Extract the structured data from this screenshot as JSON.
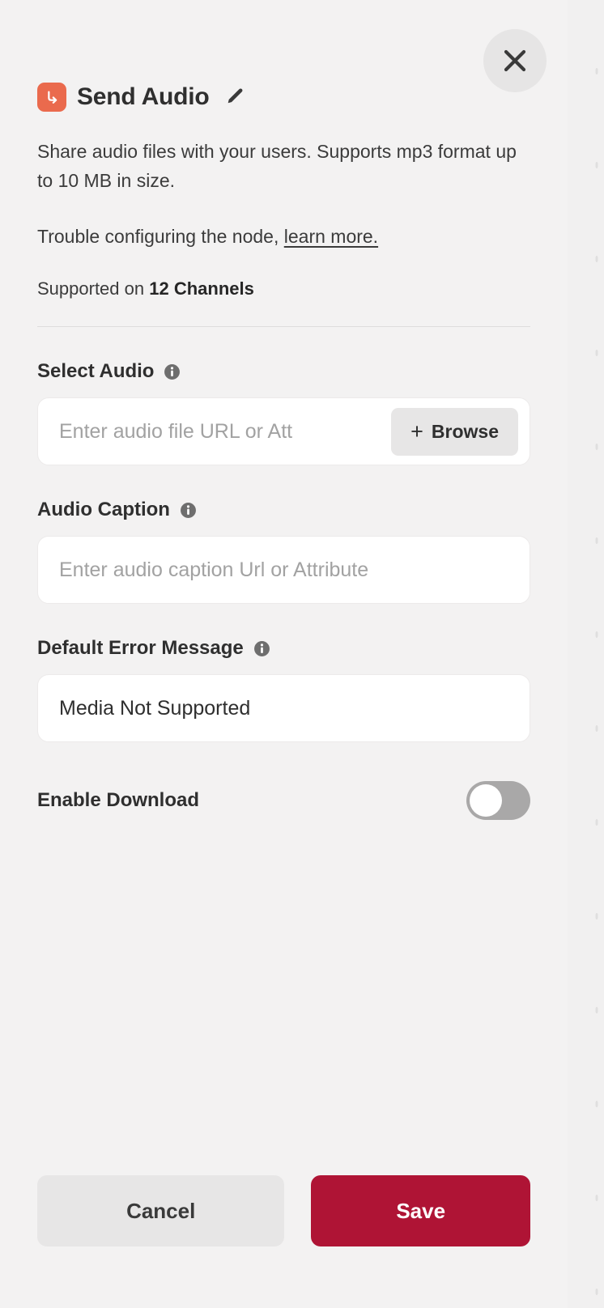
{
  "header": {
    "close_label": "Close",
    "node_icon": "corner-down-right-arrow-icon",
    "title": "Send Audio",
    "edit_icon": "pencil-icon",
    "accent_color": "#ea6a4d"
  },
  "description": {
    "text": "Share audio files with your users. Supports mp3 format up to 10 MB in size.",
    "trouble_prefix": "Trouble configuring the node, ",
    "learn_more_link": "learn more.",
    "supported_prefix": "Supported on ",
    "supported_value": "12 Channels"
  },
  "fields": {
    "select_audio": {
      "label": "Select Audio",
      "info_icon": "info-icon",
      "placeholder": "Enter audio file URL or Att",
      "value": "",
      "browse_label": "Browse",
      "browse_plus": "+"
    },
    "audio_caption": {
      "label": "Audio Caption",
      "info_icon": "info-icon",
      "placeholder": "Enter audio caption Url or Attribute",
      "value": ""
    },
    "default_error_message": {
      "label": "Default Error Message",
      "info_icon": "info-icon",
      "placeholder": "",
      "value": "Media Not Supported"
    },
    "enable_download": {
      "label": "Enable Download",
      "state": "off"
    }
  },
  "footer": {
    "cancel_label": "Cancel",
    "save_label": "Save",
    "save_color": "#af1435"
  }
}
